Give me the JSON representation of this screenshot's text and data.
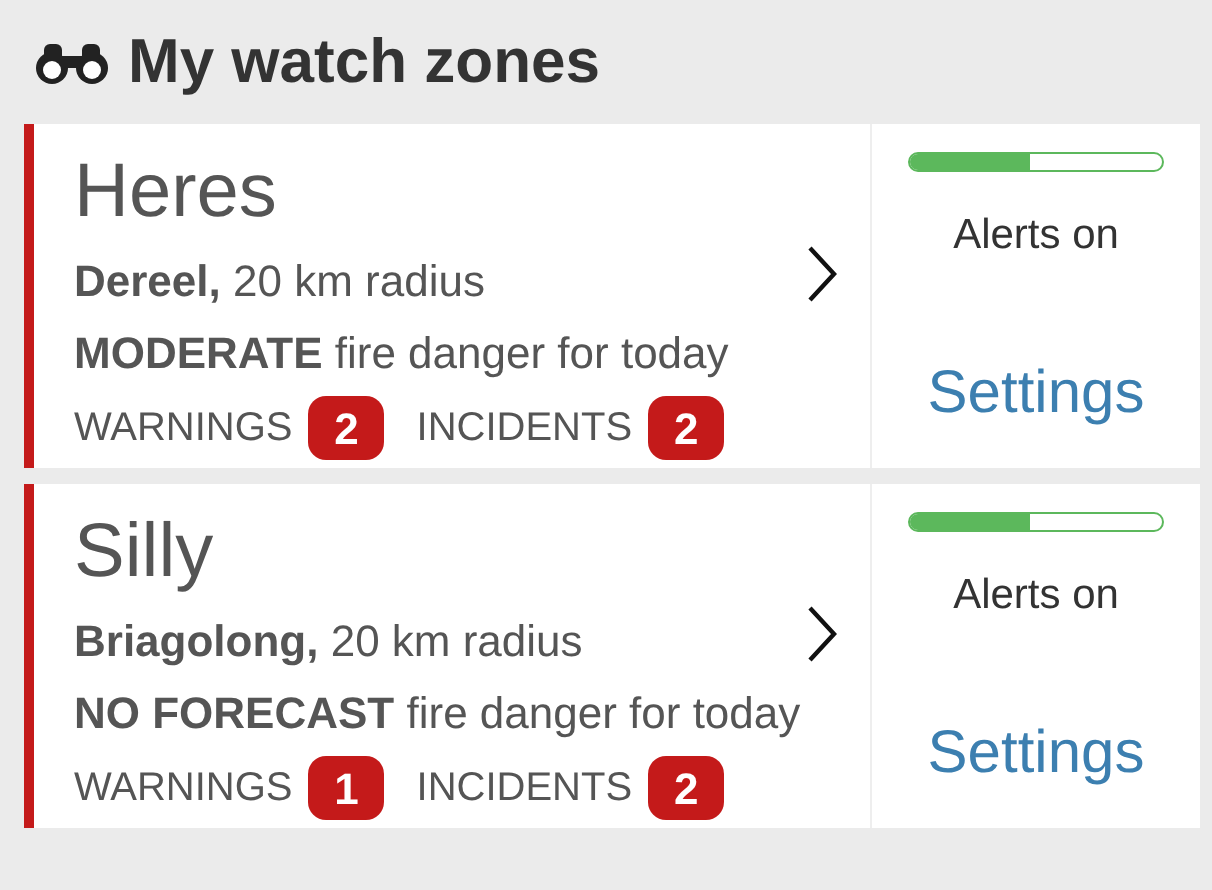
{
  "header": {
    "title": "My watch zones"
  },
  "zones": [
    {
      "name": "Heres",
      "location": "**Dereel,** 20 km radius",
      "danger": "**MODERATE** fire danger for today",
      "warnings_label": "WARNINGS",
      "warnings": "2",
      "incidents_label": "INCIDENTS",
      "incidents": "2",
      "level": 0.48,
      "alerts": "Alerts on",
      "settings": "Settings"
    },
    {
      "name": "Silly",
      "location": "**Briagolong,** 20 km radius",
      "danger": "**NO FORECAST** fire danger for today",
      "warnings_label": "WARNINGS",
      "warnings": "1",
      "incidents_label": "INCIDENTS",
      "incidents": "2",
      "level": 0.48,
      "alerts": "Alerts on",
      "settings": "Settings"
    }
  ]
}
